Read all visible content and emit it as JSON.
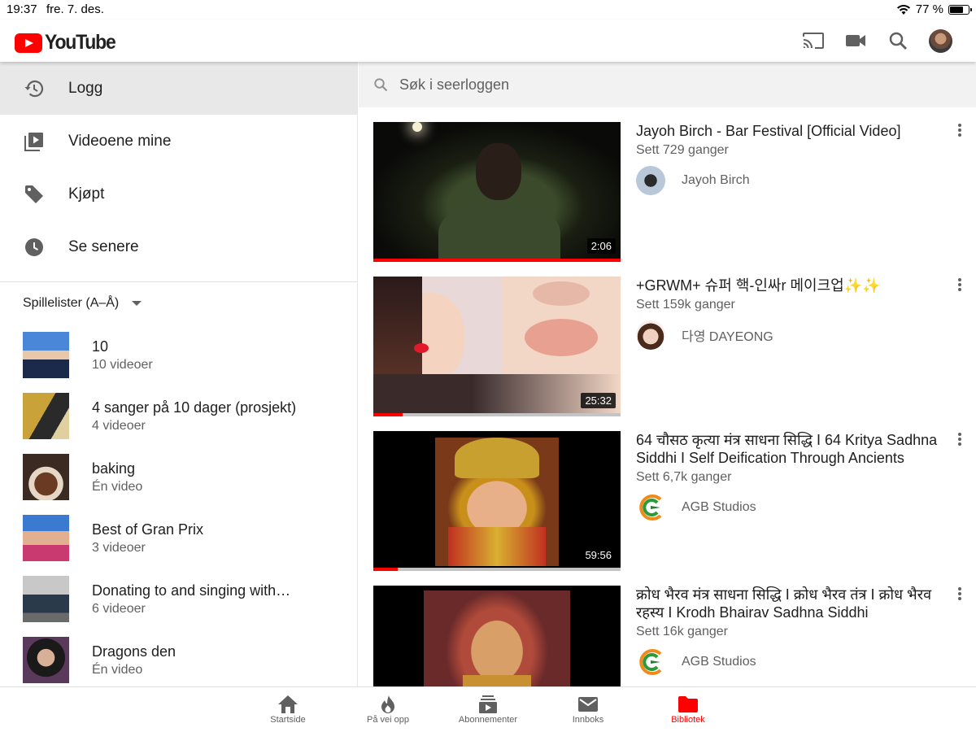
{
  "status": {
    "time": "19:37",
    "date": "fre. 7. des.",
    "battery": "77 %",
    "battery_level": 0.77
  },
  "app": {
    "logo_text": "YouTube",
    "brand_color": "#ff0000"
  },
  "header": {
    "icons": [
      "cast-icon",
      "video-camera-icon",
      "search-icon",
      "account-avatar"
    ]
  },
  "sidebar": {
    "items": [
      {
        "label": "Logg",
        "icon": "history-icon",
        "active": true
      },
      {
        "label": "Videoene mine",
        "icon": "my-videos-icon"
      },
      {
        "label": "Kjøpt",
        "icon": "tag-icon"
      },
      {
        "label": "Se senere",
        "icon": "clock-icon"
      }
    ],
    "playlists_header": "Spillelister (A–Å)",
    "playlists": [
      {
        "title": "10",
        "count": "10 videoer"
      },
      {
        "title": "4 sanger på 10 dager (prosjekt)",
        "count": "4 videoer"
      },
      {
        "title": "baking",
        "count": "Én video"
      },
      {
        "title": "Best of Gran Prix",
        "count": "3 videoer"
      },
      {
        "title": "Donating to and singing with…",
        "count": "6 videoer"
      },
      {
        "title": "Dragons den",
        "count": "Én video"
      }
    ]
  },
  "main": {
    "search_placeholder": "Søk i seerloggen",
    "videos": [
      {
        "title": "Jayoh Birch - Bar Festival [Official Video]",
        "views": "Sett 729 ganger",
        "channel": "Jayoh Birch",
        "duration": "2:06",
        "progress": 1.0
      },
      {
        "title": "+GRWM+ 슈퍼 핵-인싸r 메이크업✨✨",
        "views": "Sett 159k ganger",
        "channel": "다영 DAYEONG",
        "duration": "25:32",
        "progress": 0.12
      },
      {
        "title": "64 चौसठ कृत्या मंत्र साधना सिद्धि I 64 Kritya Sadhna Siddhi I Self Deification Through Ancients",
        "views": "Sett 6,7k ganger",
        "channel": "AGB Studios",
        "duration": "59:56",
        "progress": 0.1
      },
      {
        "title": "क्रोध भैरव मंत्र साधना सिद्धि I क्रोध भैरव तंत्र I क्रोध भैरव रहस्य I Krodh Bhairav Sadhna Siddhi",
        "views": "Sett 16k ganger",
        "channel": "AGB Studios",
        "duration": "",
        "progress": 0
      }
    ]
  },
  "tabs": [
    {
      "label": "Startside",
      "icon": "home-icon"
    },
    {
      "label": "På vei opp",
      "icon": "trending-flame-icon"
    },
    {
      "label": "Abonnementer",
      "icon": "subscriptions-icon"
    },
    {
      "label": "Innboks",
      "icon": "inbox-mail-icon"
    },
    {
      "label": "Bibliotek",
      "icon": "library-folder-icon",
      "active": true
    }
  ]
}
